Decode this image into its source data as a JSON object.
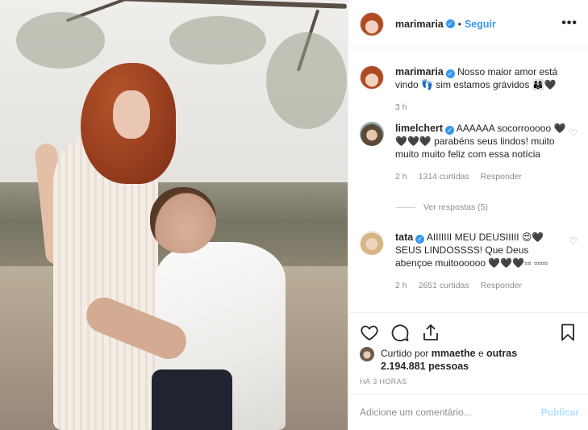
{
  "post": {
    "author": "marimaria",
    "follow_label": "Seguir",
    "separator": "•",
    "more_label": "•••"
  },
  "caption": {
    "author": "marimaria",
    "text": "Nosso maior amor está vindo 👣 sim estamos grávidos 👨‍👩‍👦🖤",
    "time": "3 h"
  },
  "comments": [
    {
      "author": "limelchert",
      "text": "AAAAAA socorrooooo 🖤🖤🖤🖤 parabéns seus lindos! muito muito muito feliz com essa notícia",
      "time": "2 h",
      "likes": "1314 curtidas",
      "reply": "Responder",
      "view_replies": "Ver respostas (5)"
    },
    {
      "author": "tata",
      "text": "AIIIIIII MEU DEUSIIIII 😍🖤 SEUS LINDOSSSS! Que Deus abençoe muitoooooo 🖤🖤🖤▫▫ ▫▫▫▫",
      "time": "2 h",
      "likes": "2651 curtidas",
      "reply": "Responder"
    }
  ],
  "likes": {
    "prefix": "Curtido por",
    "user": "mmaethe",
    "connector": "e",
    "others": "outras 2.194.881 pessoas"
  },
  "timestamp": "HÁ 3 HORAS",
  "add_comment": {
    "placeholder": "Adicione um comentário...",
    "publish": "Publicar"
  },
  "colors": {
    "accent": "#3897f0",
    "publish_disabled": "#b2dffc",
    "muted": "#8e8e8e"
  },
  "icons": [
    "heart-icon",
    "comment-icon",
    "share-icon",
    "bookmark-icon",
    "verified-icon",
    "more-options-icon"
  ]
}
